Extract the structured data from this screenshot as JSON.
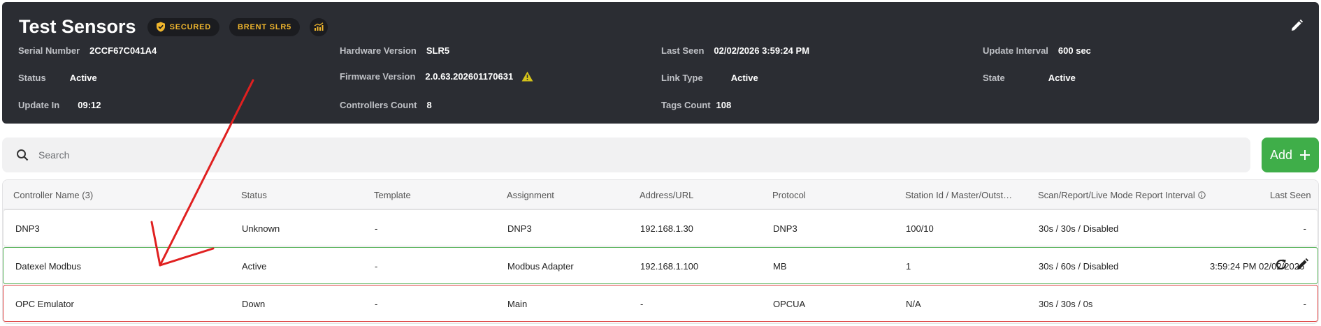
{
  "header": {
    "title": "Test Sensors",
    "secured_badge": "SECURED",
    "device_badge": "BRENT SLR5",
    "fields": {
      "serial_number": {
        "label": "Serial Number",
        "value": "2CCF67C041A4"
      },
      "hardware_version": {
        "label": "Hardware Version",
        "value": "SLR5"
      },
      "last_seen": {
        "label": "Last Seen",
        "value": "02/02/2026 3:59:24 PM"
      },
      "update_interval": {
        "label": "Update Interval",
        "value": "600 sec"
      },
      "status": {
        "label": "Status",
        "value": "Active"
      },
      "firmware_version": {
        "label": "Firmware Version",
        "value": "2.0.63.202601170631"
      },
      "link_type": {
        "label": "Link Type",
        "value": "Active"
      },
      "state": {
        "label": "State",
        "value": "Active"
      },
      "update_in": {
        "label": "Update In",
        "value": "09:12"
      },
      "controllers_count": {
        "label": "Controllers Count",
        "value": "8"
      },
      "tags_count": {
        "label": "Tags Count",
        "value": "108"
      }
    }
  },
  "toolbar": {
    "search_placeholder": "Search",
    "add_label": "Add"
  },
  "table": {
    "columns": [
      "Controller Name (3)",
      "Status",
      "Template",
      "Assignment",
      "Address/URL",
      "Protocol",
      "Station Id / Master/Outst…",
      "Scan/Report/Live Mode Report Interval",
      "Last Seen"
    ],
    "rows": [
      {
        "name": "DNP3",
        "status": "Unknown",
        "template": "-",
        "assignment": "DNP3",
        "address": "192.168.1.30",
        "protocol": "DNP3",
        "station": "100/10",
        "interval": "30s / 30s / Disabled",
        "last_seen": "-"
      },
      {
        "name": "Datexel Modbus",
        "status": "Active",
        "template": "-",
        "assignment": "Modbus Adapter",
        "address": "192.168.1.100",
        "protocol": "MB",
        "station": "1",
        "interval": "30s / 60s / Disabled",
        "last_seen": "3:59:24 PM 02/02/2026"
      },
      {
        "name": "OPC Emulator",
        "status": "Down",
        "template": "-",
        "assignment": "Main",
        "address": "-",
        "protocol": "OPCUA",
        "station": "N/A",
        "interval": "30s / 30s / 0s",
        "last_seen": "-"
      }
    ]
  },
  "colors": {
    "header_bg": "#2b2d33",
    "badge_text": "#f0b62d",
    "add_button": "#3fae49",
    "active_row_border": "#5db55f",
    "down_row_border": "#e04848",
    "annotation_arrow": "#e02020",
    "warning": "#d4c21a"
  },
  "icons": {
    "secured": "shield-check-icon",
    "chart": "chart-icon",
    "edit": "pencil-icon",
    "warning": "warning-icon",
    "search": "search-icon",
    "add": "plus-icon",
    "info": "info-icon",
    "refresh": "refresh-icon"
  }
}
